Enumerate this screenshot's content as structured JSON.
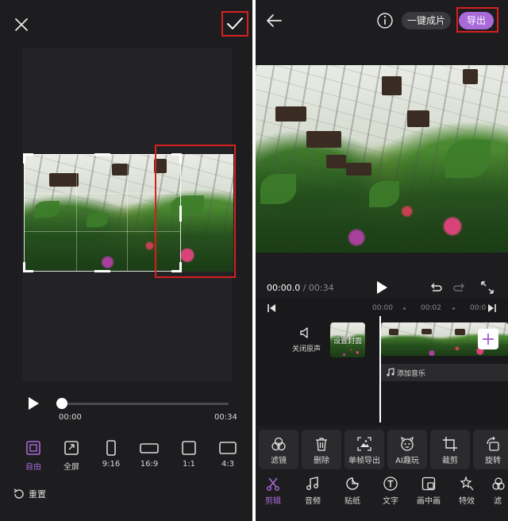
{
  "crop_screen": {
    "playback": {
      "current": "00:00",
      "total": "00:34",
      "progress": 0.0
    },
    "ratios": [
      {
        "label": "自由",
        "icon": "free-ratio-icon",
        "selected": true
      },
      {
        "label": "全屏",
        "icon": "fullscreen-icon",
        "selected": false
      },
      {
        "label": "9:16",
        "icon": "ratio-9-16-icon",
        "selected": false
      },
      {
        "label": "16:9",
        "icon": "ratio-16-9-icon",
        "selected": false
      },
      {
        "label": "1:1",
        "icon": "ratio-1-1-icon",
        "selected": false
      },
      {
        "label": "4:3",
        "icon": "ratio-4-3-icon",
        "selected": false
      }
    ],
    "reset_label": "重置"
  },
  "edit_screen": {
    "header": {
      "one_click_label": "一键成片",
      "export_label": "导出"
    },
    "playback": {
      "current": "00:00.0",
      "separator": "/",
      "total": "00:34"
    },
    "ruler": {
      "marks": [
        "00:00",
        "00:02",
        "00:0"
      ]
    },
    "track": {
      "mute_label": "关闭原声",
      "cover_label": "设置封面",
      "add_music_label": "添加音乐"
    },
    "tools": [
      {
        "label": "滤镜",
        "icon": "filter-icon"
      },
      {
        "label": "删除",
        "icon": "trash-icon"
      },
      {
        "label": "单帧导出",
        "icon": "frame-export-icon"
      },
      {
        "label": "AI趣玩",
        "icon": "ai-fun-icon"
      },
      {
        "label": "裁剪",
        "icon": "crop-icon"
      },
      {
        "label": "旋转",
        "icon": "rotate-icon"
      }
    ],
    "tabs": [
      {
        "label": "剪辑",
        "icon": "scissors-icon",
        "active": true
      },
      {
        "label": "音频",
        "icon": "music-note-icon",
        "active": false
      },
      {
        "label": "贴纸",
        "icon": "sticker-icon",
        "active": false
      },
      {
        "label": "文字",
        "icon": "text-icon",
        "active": false
      },
      {
        "label": "画中画",
        "icon": "pip-icon",
        "active": false
      },
      {
        "label": "特效",
        "icon": "effects-icon",
        "active": false
      },
      {
        "label": "滤",
        "icon": "filter-tab-icon",
        "active": false
      }
    ]
  },
  "colors": {
    "accent": "#a86ad8",
    "highlight": "#d62020",
    "panel_bg": "#1d1d1f"
  }
}
